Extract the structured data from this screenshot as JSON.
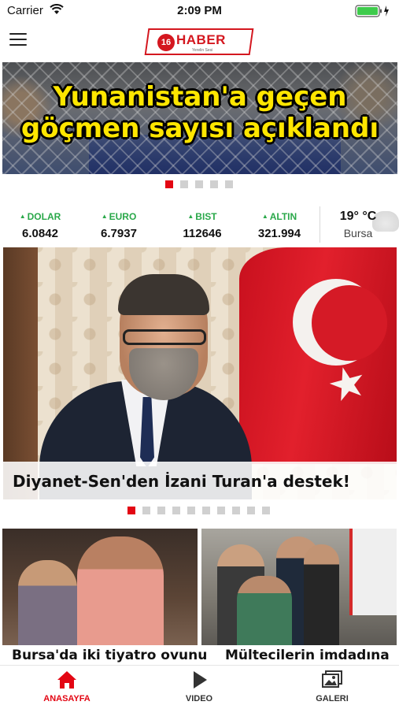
{
  "status_bar": {
    "carrier": "Carrier",
    "time": "2:09 PM"
  },
  "header": {
    "menu_icon": "hamburger-menu-icon",
    "logo": {
      "number": "16",
      "text": "HABER",
      "tagline": "Yerelin Sesi"
    }
  },
  "hero": {
    "title_line1": "Yunanistan'a geçen",
    "title_line2": "göçmen sayısı açıklandı",
    "slides": 5,
    "active_slide": 1
  },
  "markets": [
    {
      "name": "DOLAR",
      "value": "6.0842",
      "trend": "up"
    },
    {
      "name": "EURO",
      "value": "6.7937",
      "trend": "up"
    },
    {
      "name": "BIST",
      "value": "112646",
      "trend": "up"
    },
    {
      "name": "ALTIN",
      "value": "321.994",
      "trend": "up"
    }
  ],
  "weather": {
    "temp": "19° °C",
    "city": "Bursa",
    "icon": "cloud-icon"
  },
  "main_story": {
    "headline": "Diyanet-Sen'den İzani Turan'a destek!",
    "slides": 10,
    "active_slide": 1
  },
  "thumbnails": [
    {
      "caption": "Bursa'da iki tiyatro ovunu"
    },
    {
      "caption": "Mültecilerin imdadına"
    }
  ],
  "tabbar": [
    {
      "label": "ANASAYFA",
      "icon": "home-icon",
      "active": true
    },
    {
      "label": "VIDEO",
      "icon": "play-icon",
      "active": false
    },
    {
      "label": "GALERI",
      "icon": "gallery-icon",
      "active": false
    }
  ],
  "colors": {
    "accent": "#e30613",
    "market_up": "#2aa84a",
    "hero_text": "#ffe600"
  }
}
